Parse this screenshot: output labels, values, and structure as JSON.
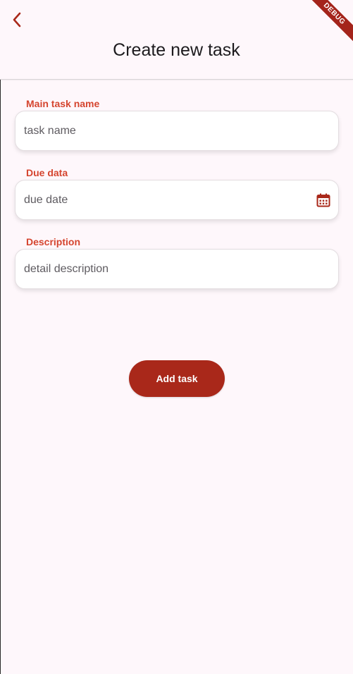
{
  "header": {
    "title": "Create new task",
    "debug_banner": "DEBUG",
    "back_icon": "chevron-left-icon"
  },
  "form": {
    "task_name": {
      "label": "Main task name",
      "placeholder": "task name",
      "value": ""
    },
    "due_date": {
      "label": "Due data",
      "placeholder": "due date",
      "value": "",
      "icon": "calendar-icon"
    },
    "description": {
      "label": "Description",
      "placeholder": "detail description",
      "value": ""
    }
  },
  "actions": {
    "add_task_label": "Add task"
  },
  "colors": {
    "background": "#fef7fb",
    "accent": "#a9281a",
    "label": "#d5452f",
    "title": "#1d1b1e"
  }
}
